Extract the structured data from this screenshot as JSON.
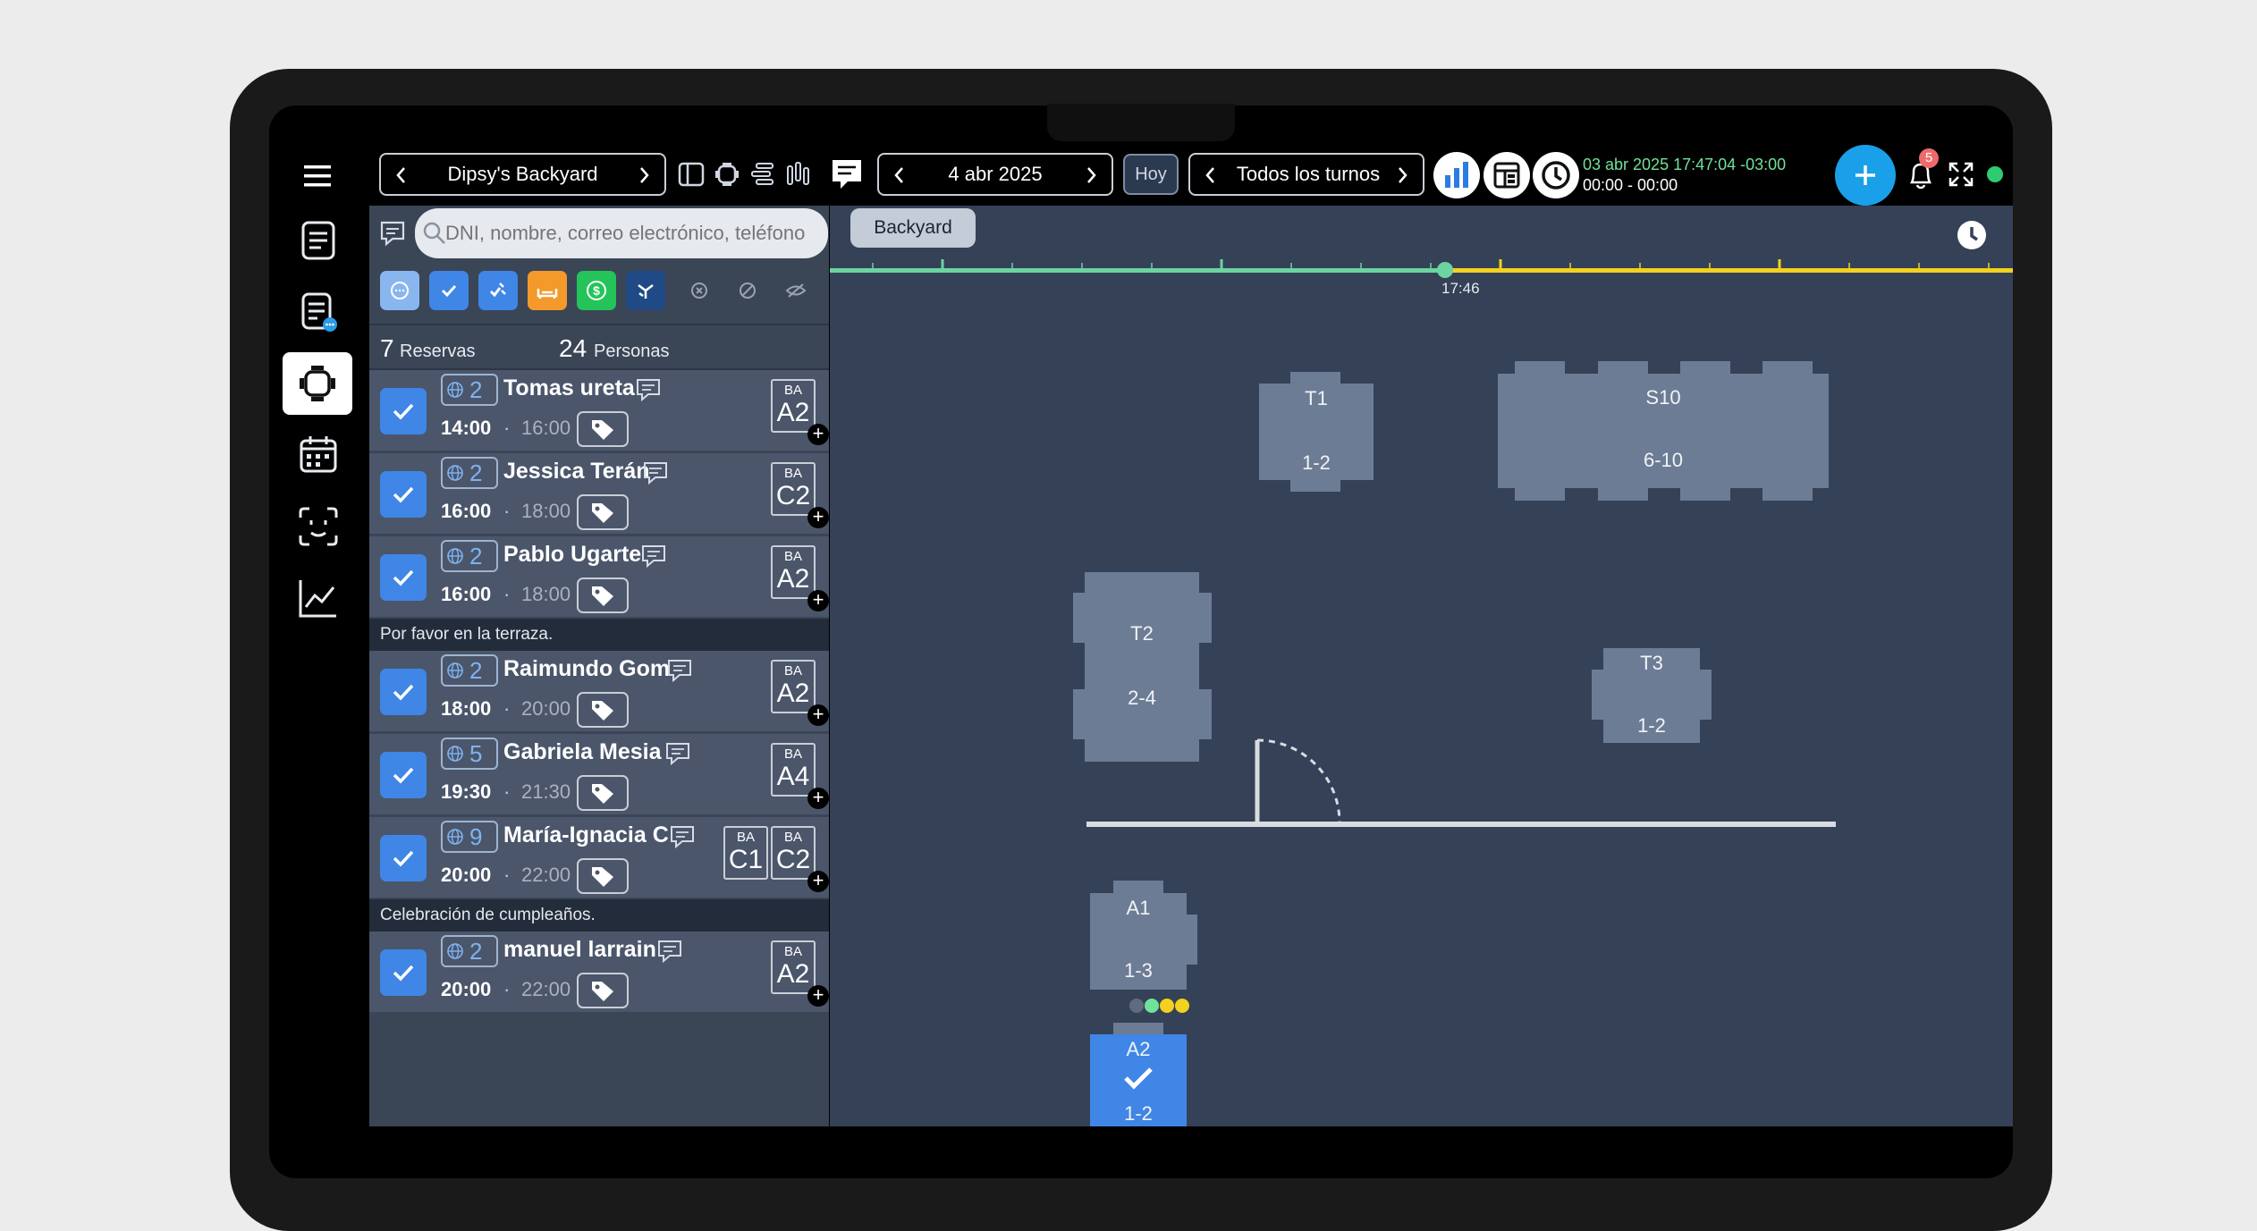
{
  "toolbar": {
    "venue": "Dipsy's Backyard",
    "date": "4 abr 2025",
    "today_label": "Hoy",
    "shift": "Todos los turnos",
    "datetime": "03 abr 2025 17:47:04 -03:00",
    "time_range": "00:00 - 00:00",
    "notification_count": "5"
  },
  "search": {
    "placeholder": "DNI, nombre, correo electrónico, teléfono"
  },
  "summary": {
    "reservations_count": "7",
    "reservations_label": "Reservas",
    "people_count": "24",
    "people_label": "Personas"
  },
  "reservations": [
    {
      "pax": "2",
      "name": "Tomas ureta",
      "start": "14:00",
      "end": "16:00",
      "zone": "BA",
      "tables": [
        "A2"
      ]
    },
    {
      "pax": "2",
      "name": "Jessica Terán",
      "start": "16:00",
      "end": "18:00",
      "zone": "BA",
      "tables": [
        "C2"
      ]
    },
    {
      "pax": "2",
      "name": "Pablo Ugarte",
      "start": "16:00",
      "end": "18:00",
      "zone": "BA",
      "tables": [
        "A2"
      ],
      "note": "Por favor en la terraza."
    },
    {
      "pax": "2",
      "name": "Raimundo Gom",
      "start": "18:00",
      "end": "20:00",
      "zone": "BA",
      "tables": [
        "A2"
      ]
    },
    {
      "pax": "5",
      "name": "Gabriela Mesia",
      "start": "19:30",
      "end": "21:30",
      "zone": "BA",
      "tables": [
        "A4"
      ]
    },
    {
      "pax": "9",
      "name": "María-Ignacia C",
      "start": "20:00",
      "end": "22:00",
      "zone": "BA",
      "tables": [
        "C1",
        "C2"
      ],
      "note": "Celebración de cumpleaños."
    },
    {
      "pax": "2",
      "name": "manuel larrain",
      "start": "20:00",
      "end": "22:00",
      "zone": "BA",
      "tables": [
        "A2"
      ]
    }
  ],
  "floor": {
    "area_tab": "Backyard",
    "current_time": "17:46",
    "timeline_progress": 0.52,
    "tables": [
      {
        "id": "T1",
        "capacity": "1-2"
      },
      {
        "id": "S10",
        "capacity": "6-10"
      },
      {
        "id": "T2",
        "capacity": "2-4"
      },
      {
        "id": "T3",
        "capacity": "1-2"
      },
      {
        "id": "A1",
        "capacity": "1-3"
      },
      {
        "id": "A2",
        "capacity": "1-2"
      }
    ]
  },
  "colors": {
    "accent": "#3f86e6",
    "timeline_past": "#6dd3a0",
    "timeline_future": "#f3d11e",
    "status_green": "#2ecc71",
    "add_button": "#1aa0e8"
  }
}
